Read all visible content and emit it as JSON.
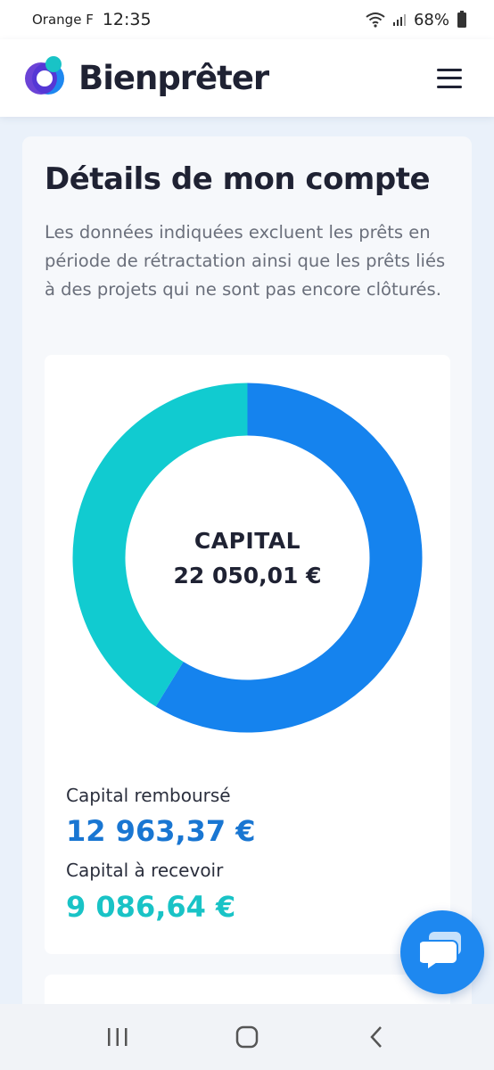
{
  "status_bar": {
    "carrier": "Orange F",
    "time": "12:35",
    "battery": "68%",
    "icons": [
      "wifi-icon",
      "signal-icon",
      "battery-icon"
    ]
  },
  "header": {
    "brand": "Bienprêter",
    "logo_colors": [
      "#1e88f0",
      "#5b2fd1",
      "#19c3c6"
    ],
    "menu_icon": "hamburger-menu-icon"
  },
  "main": {
    "title": "Détails de mon compte",
    "description": "Les données indiquées excluent les prêts en période de rétractation ainsi que les prêts liés à des projets qui ne sont pas encore clôturés."
  },
  "chart_data": {
    "type": "pie",
    "title": "CAPITAL",
    "total": "22 050,01 €",
    "categories": [
      "Capital remboursé",
      "Capital à recevoir"
    ],
    "values": [
      12963.37,
      9086.64
    ],
    "colors": [
      "#1583ee",
      "#11cbd0"
    ],
    "legend": [
      {
        "label": "Capital remboursé",
        "value": "12 963,37 €",
        "color": "#1976d2"
      },
      {
        "label": "Capital à recevoir",
        "value": "9 086,64 €",
        "color": "#19c3c6"
      }
    ]
  },
  "chat": {
    "icon": "chat-bubble-icon",
    "color": "#1e88f0"
  },
  "nav_bar": {
    "icons": [
      "recent-apps-icon",
      "home-icon",
      "back-icon"
    ]
  }
}
